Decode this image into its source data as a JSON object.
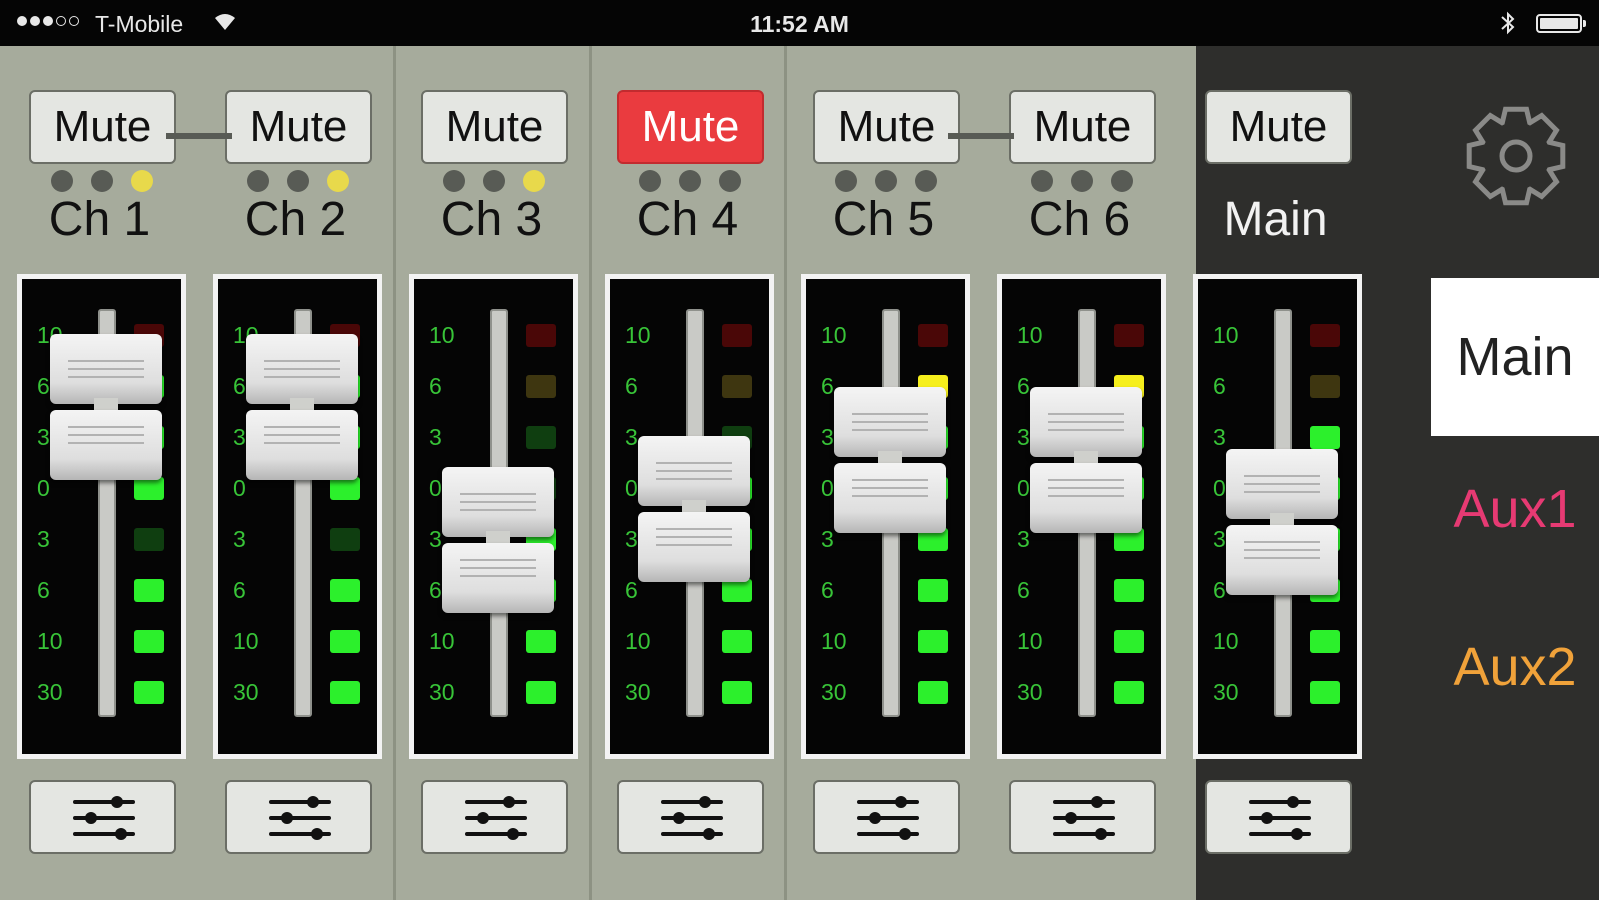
{
  "status_bar": {
    "carrier": "T-Mobile",
    "time": "11:52 AM",
    "signal_bars": 3
  },
  "channels": [
    {
      "label": "Ch 1",
      "mute": "Mute",
      "muted": false,
      "leds": [
        "off",
        "off",
        "yellow"
      ],
      "fader_pct": 86,
      "meter": [
        "dim-red",
        "bright",
        "bright",
        "bright",
        "dim-green",
        "bright-green",
        "bright-green",
        "bright-green"
      ]
    },
    {
      "label": "Ch 2",
      "mute": "Mute",
      "muted": false,
      "leds": [
        "off",
        "off",
        "yellow"
      ],
      "fader_pct": 86,
      "meter": [
        "dim-red",
        "bright",
        "bright",
        "bright",
        "dim-green",
        "bright-green",
        "bright-green",
        "bright-green"
      ]
    },
    {
      "label": "Ch 3",
      "mute": "Mute",
      "muted": false,
      "leds": [
        "off",
        "off",
        "yellow"
      ],
      "fader_pct": 43,
      "meter": [
        "dim-red",
        "dim-yellow",
        "dim-green",
        "dim-green",
        "bright-green",
        "bright-green",
        "bright-green",
        "bright-green"
      ]
    },
    {
      "label": "Ch 4",
      "mute": "Mute",
      "muted": true,
      "leds": [
        "off",
        "off",
        "off"
      ],
      "fader_pct": 53,
      "meter": [
        "dim-red",
        "dim-yellow",
        "dim-green",
        "bright-green",
        "bright-green",
        "bright-green",
        "bright-green",
        "bright-green"
      ]
    },
    {
      "label": "Ch 5",
      "mute": "Mute",
      "muted": false,
      "leds": [
        "off",
        "off",
        "off"
      ],
      "fader_pct": 69,
      "meter": [
        "dim-red",
        "bright-yellow",
        "bright-green",
        "bright-green",
        "bright-green",
        "bright-green",
        "bright-green",
        "bright-green"
      ]
    },
    {
      "label": "Ch 6",
      "mute": "Mute",
      "muted": false,
      "leds": [
        "off",
        "off",
        "off"
      ],
      "fader_pct": 69,
      "meter": [
        "dim-red",
        "bright-yellow",
        "bright-green",
        "bright-green",
        "bright-green",
        "bright-green",
        "bright-green",
        "bright-green"
      ]
    },
    {
      "label": "Main",
      "mute": "Mute",
      "muted": false,
      "leds": [],
      "fader_pct": 49,
      "meter": [
        "dim-red",
        "dim-yellow",
        "bright-green",
        "bright-green",
        "bright-green",
        "bright-green",
        "bright-green",
        "bright-green"
      ]
    }
  ],
  "scale_labels": [
    "10",
    "6",
    "3",
    "0",
    "3",
    "6",
    "10",
    "30"
  ],
  "buses": [
    {
      "label": "Main",
      "selected": true,
      "color": "#222222"
    },
    {
      "label": "Aux1",
      "selected": false,
      "color": "#e63a73"
    },
    {
      "label": "Aux2",
      "selected": false,
      "color": "#f0a23a"
    }
  ],
  "colors": {
    "strip_bg": "#a6ab9c",
    "master_bg": "#2e2e2c",
    "mute_active": "#ea3b3f",
    "meter_green": "#2cf02c"
  },
  "icons": {
    "settings": "gear-icon",
    "eq": "sliders-icon"
  }
}
